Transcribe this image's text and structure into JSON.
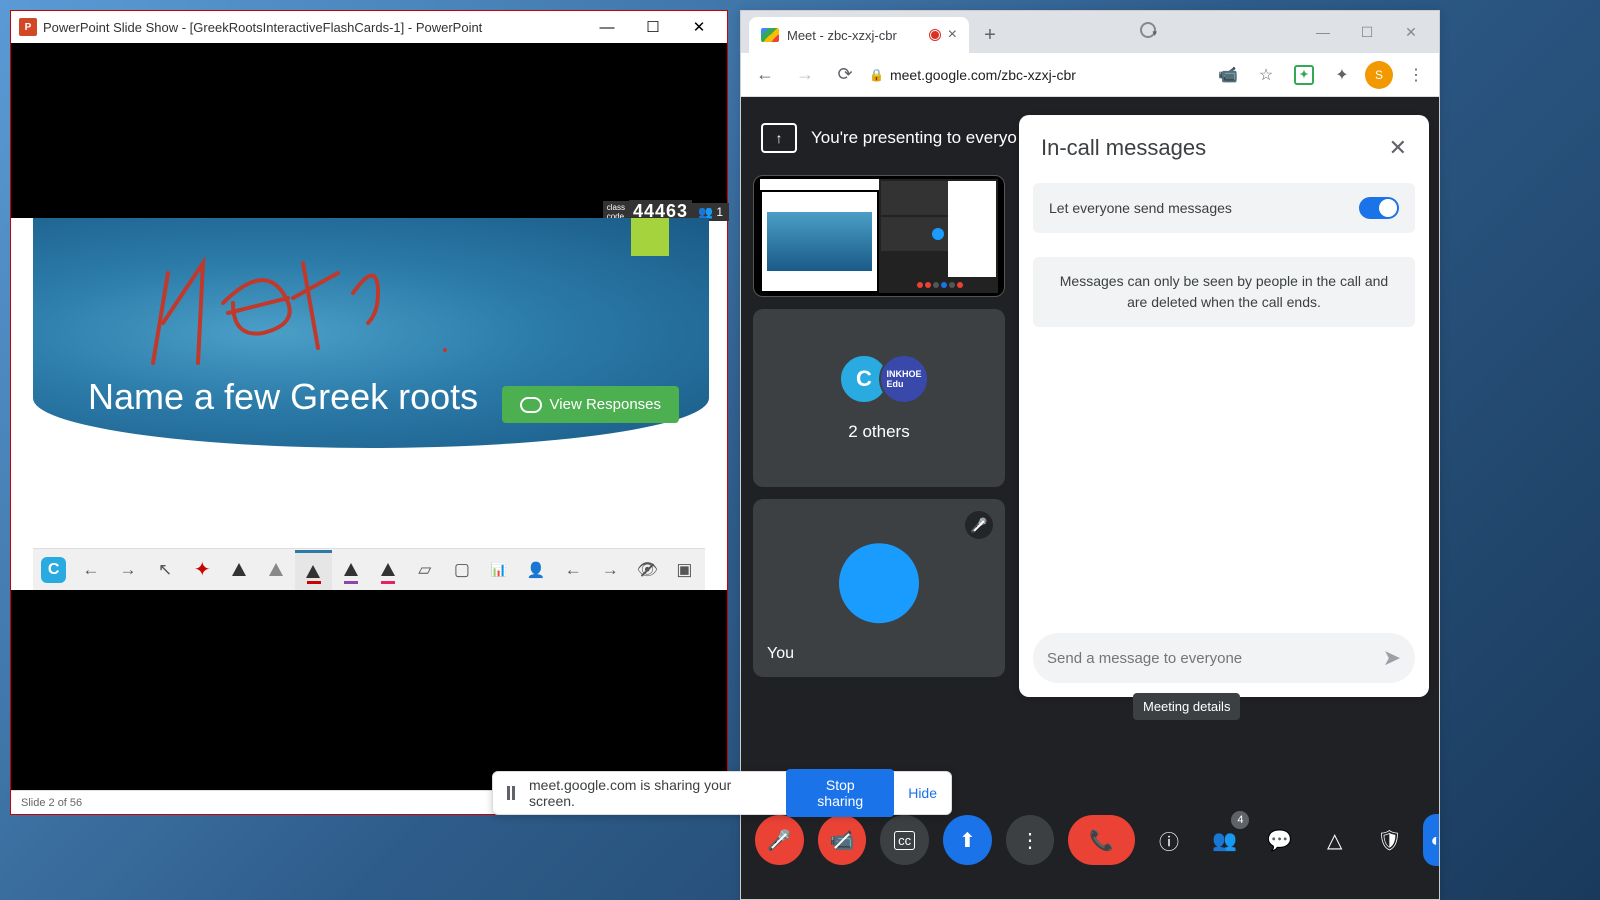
{
  "powerpoint": {
    "title": "PowerPoint Slide Show - [GreekRootsInteractiveFlashCards-1] - PowerPoint",
    "slide_question": "Name a few Greek roots",
    "view_responses_label": "View Responses",
    "class_code_label": "class\ncode",
    "class_code": "44463",
    "participants": "1",
    "status_left": "Slide 2 of 56",
    "ink_text": "Notes"
  },
  "chrome": {
    "tab_title": "Meet - zbc-xzxj-cbr",
    "url": "meet.google.com/zbc-xzxj-cbr",
    "avatar_letter": "S"
  },
  "meet": {
    "presenting_banner": "You're presenting to everyo",
    "others_label": "2 others",
    "you_label": "You",
    "people_badge": "4"
  },
  "chat": {
    "title": "In-call messages",
    "toggle_label": "Let everyone send messages",
    "info_text": "Messages can only be seen by people in the call and are deleted when the call ends.",
    "input_placeholder": "Send a message to everyone",
    "tooltip": "Meeting details"
  },
  "share_bar": {
    "text": "meet.google.com is sharing your screen.",
    "stop_label": "Stop sharing",
    "hide_label": "Hide"
  }
}
